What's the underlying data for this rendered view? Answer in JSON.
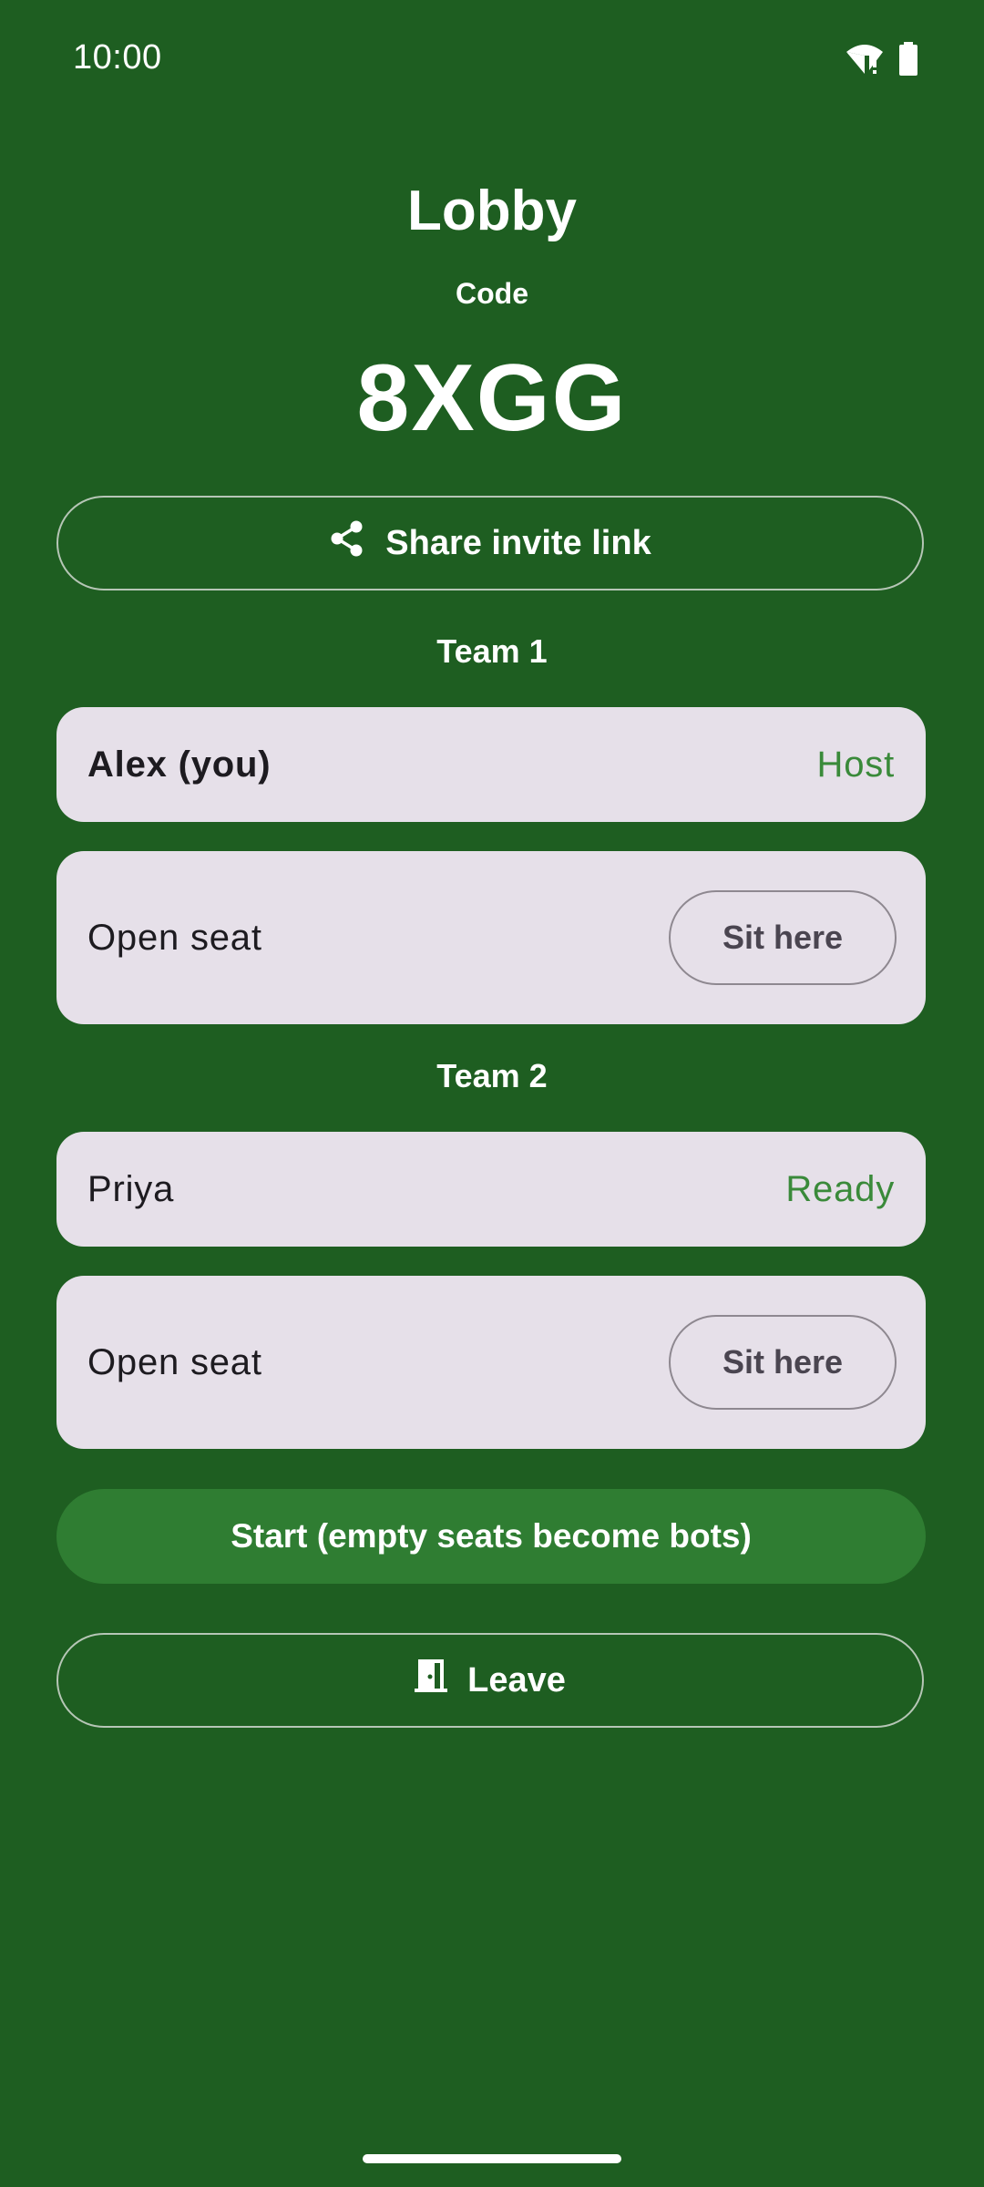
{
  "status_bar": {
    "time": "10:00",
    "icons": [
      "wifi-alert-icon",
      "battery-icon"
    ]
  },
  "lobby": {
    "title": "Lobby",
    "code_label": "Code",
    "code": "8XGG"
  },
  "share": {
    "icon": "share-icon",
    "label": "Share invite link"
  },
  "teams": [
    {
      "heading": "Team 1",
      "seats": [
        {
          "type": "player",
          "name": "Alex (you)",
          "status": "Host"
        },
        {
          "type": "open",
          "name": "Open seat",
          "action": "Sit here"
        }
      ]
    },
    {
      "heading": "Team 2",
      "seats": [
        {
          "type": "player",
          "name": "Priya",
          "status": "Ready"
        },
        {
          "type": "open",
          "name": "Open seat",
          "action": "Sit here"
        }
      ]
    }
  ],
  "actions": {
    "start_label": "Start (empty seats become bots)",
    "leave_label": "Leave",
    "leave_icon": "door-exit-icon"
  },
  "colors": {
    "background": "#1e5e21",
    "card": "#e6e0e9",
    "status_green": "#3a8a3a",
    "primary_button": "#2f7d32"
  }
}
